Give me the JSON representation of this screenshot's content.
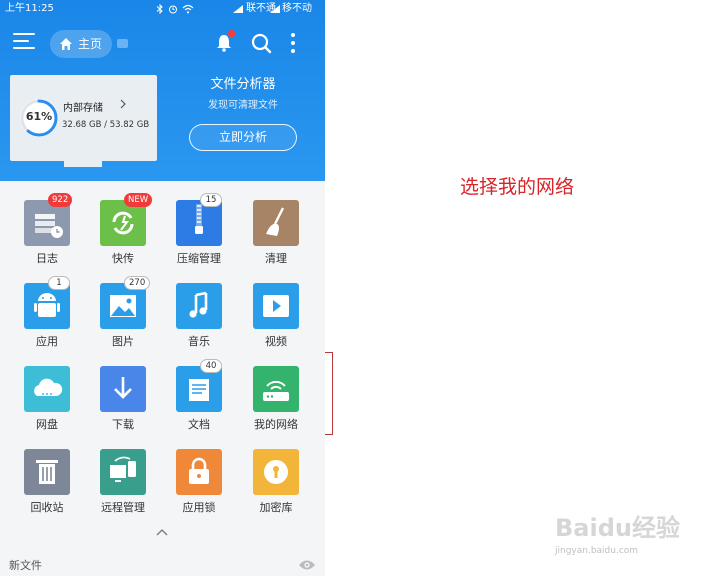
{
  "status_bar": {
    "time": "上午11:25",
    "carrier1": "联不通",
    "carrier2": "移不动"
  },
  "app_bar": {
    "home_label": "主页"
  },
  "storage": {
    "percent_text": "61%",
    "percent_value": 61,
    "title": "内部存储",
    "size": "32.68 GB / 53.82 GB"
  },
  "analyzer": {
    "title": "文件分析器",
    "subtitle": "发现可清理文件",
    "button": "立即分析"
  },
  "tiles": [
    {
      "label": "日志",
      "badge": "922",
      "badge_style": "red",
      "icon": "log-icon",
      "color": "#8d99ae"
    },
    {
      "label": "快传",
      "badge": "NEW",
      "badge_style": "red",
      "icon": "transfer-icon",
      "color": "#6cc04a"
    },
    {
      "label": "压缩管理",
      "badge": "15",
      "badge_style": "white",
      "icon": "zip-icon",
      "color": "#2d7be5"
    },
    {
      "label": "清理",
      "badge": "",
      "badge_style": "",
      "icon": "broom-icon",
      "color": "#a88466"
    },
    {
      "label": "应用",
      "badge": "1",
      "badge_style": "white",
      "icon": "android-icon",
      "color": "#2a9ee8"
    },
    {
      "label": "图片",
      "badge": "270",
      "badge_style": "white",
      "icon": "image-icon",
      "color": "#2a9ee8"
    },
    {
      "label": "音乐",
      "badge": "",
      "badge_style": "",
      "icon": "music-icon",
      "color": "#2a9ee8"
    },
    {
      "label": "视频",
      "badge": "",
      "badge_style": "",
      "icon": "video-icon",
      "color": "#2a9ee8"
    },
    {
      "label": "网盘",
      "badge": "",
      "badge_style": "",
      "icon": "cloud-icon",
      "color": "#3dbdd6"
    },
    {
      "label": "下载",
      "badge": "",
      "badge_style": "",
      "icon": "download-icon",
      "color": "#4a86e8"
    },
    {
      "label": "文档",
      "badge": "40",
      "badge_style": "white",
      "icon": "document-icon",
      "color": "#2a9ee8"
    },
    {
      "label": "我的网络",
      "badge": "",
      "badge_style": "",
      "icon": "router-icon",
      "color": "#33b36b"
    },
    {
      "label": "回收站",
      "badge": "",
      "badge_style": "",
      "icon": "trash-icon",
      "color": "#7d8797"
    },
    {
      "label": "远程管理",
      "badge": "",
      "badge_style": "",
      "icon": "remote-icon",
      "color": "#3a9e8c"
    },
    {
      "label": "应用锁",
      "badge": "",
      "badge_style": "",
      "icon": "lock-icon",
      "color": "#f0883a"
    },
    {
      "label": "加密库",
      "badge": "",
      "badge_style": "",
      "icon": "vault-icon",
      "color": "#f2b53a"
    }
  ],
  "footer": {
    "new_files_label": "新文件"
  },
  "annotation": {
    "text": "选择我的网络"
  },
  "watermark": {
    "logo": "Baidu经验",
    "url": "jingyan.baidu.com"
  },
  "colors": {
    "header_blue": "#1a86e8",
    "annotation_red": "#d8232a",
    "badge_red": "#f13a3a"
  }
}
